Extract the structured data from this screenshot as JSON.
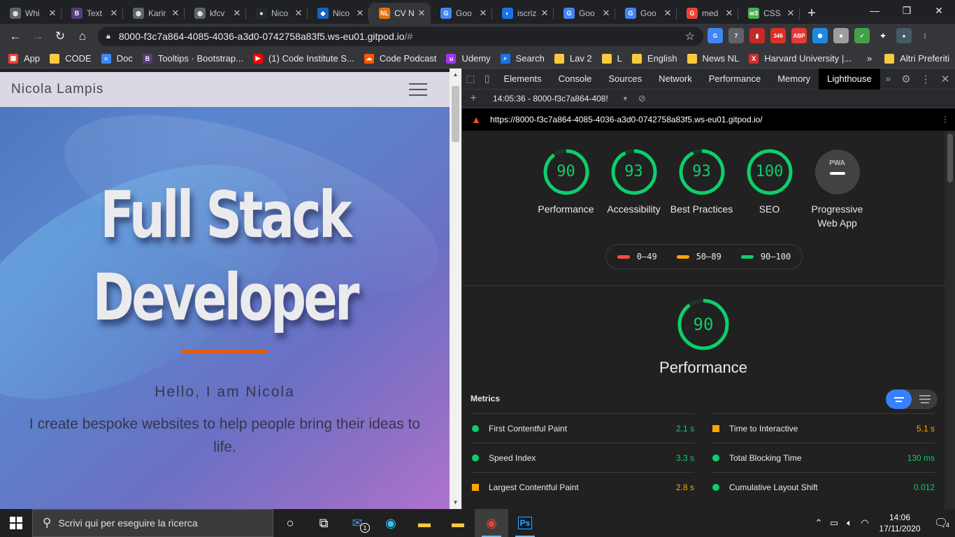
{
  "browser": {
    "tabs": [
      {
        "label": "Whi",
        "favicon": "globe-icon",
        "color": "#5f6368",
        "glyph": "◍"
      },
      {
        "label": "Text",
        "favicon": "bootstrap-icon",
        "color": "#563d7c",
        "glyph": "B"
      },
      {
        "label": "Karir",
        "favicon": "globe-icon",
        "color": "#5f6368",
        "glyph": "◍"
      },
      {
        "label": "kfcv",
        "favicon": "globe-icon",
        "color": "#5f6368",
        "glyph": "◍"
      },
      {
        "label": "Nico",
        "favicon": "github-icon",
        "color": "#24292e",
        "glyph": "●"
      },
      {
        "label": "Nico",
        "favicon": "cube-icon",
        "color": "#1565c0",
        "glyph": "◆"
      },
      {
        "label": "CV N",
        "favicon": "nl-icon",
        "color": "#e8710a",
        "glyph": "NL"
      },
      {
        "label": "Goo",
        "favicon": "google-translate-icon",
        "color": "#4285f4",
        "glyph": "G"
      },
      {
        "label": "iscriz",
        "favicon": "loop-icon",
        "color": "#1a73e8",
        "glyph": "◐"
      },
      {
        "label": "Goo",
        "favicon": "google-translate-icon",
        "color": "#4285f4",
        "glyph": "G"
      },
      {
        "label": "Goo",
        "favicon": "google-translate-icon",
        "color": "#4285f4",
        "glyph": "G"
      },
      {
        "label": "med",
        "favicon": "google-icon",
        "color": "#ea4335",
        "glyph": "G"
      },
      {
        "label": "CSS",
        "favicon": "w3-icon",
        "color": "#4caf50",
        "glyph": "w3"
      }
    ],
    "active_tab_index": 6,
    "new_tab": "+",
    "window_controls": {
      "minimize": "—",
      "maximize": "❐",
      "close": "✕"
    },
    "nav": {
      "back": "←",
      "forward": "→",
      "reload": "↻",
      "home": "⌂"
    },
    "url_host": "8000-f3c7a864-4085-4036-a3d0-0742758a83f5.ws-eu01.gitpod.io",
    "url_path": "/#",
    "star": "☆",
    "extensions": [
      {
        "name": "translate-ext-icon",
        "color": "#4285f4",
        "label": "G"
      },
      {
        "name": "tabs-ext-icon",
        "color": "#5f6368",
        "label": "7"
      },
      {
        "name": "book-ext-icon",
        "color": "#c62828",
        "label": "▮"
      },
      {
        "name": "mail-ext-icon",
        "color": "#d93025",
        "label": "346"
      },
      {
        "name": "abp-ext-icon",
        "color": "#e53935",
        "label": "ABP"
      },
      {
        "name": "hex-ext-icon",
        "color": "#1e88e5",
        "label": "⬢"
      },
      {
        "name": "box-ext-icon",
        "color": "#9e9e9e",
        "label": "■"
      },
      {
        "name": "check-ext-icon",
        "color": "#43a047",
        "label": "✓"
      },
      {
        "name": "puzzle-ext-icon",
        "color": "#35363a",
        "label": "✚"
      },
      {
        "name": "avatar-ext-icon",
        "color": "#455a64",
        "label": "●"
      },
      {
        "name": "menu-ext-icon",
        "color": "#35363a",
        "label": "⋮"
      }
    ]
  },
  "bookmarks": [
    {
      "label": "App",
      "icon": "apps-grid-icon",
      "color": "#ea4335",
      "glyph": "▦"
    },
    {
      "label": "CODE",
      "icon": "folder-icon",
      "color": "#f9c940",
      "glyph": ""
    },
    {
      "label": "Doc",
      "icon": "docs-icon",
      "color": "#4285f4",
      "glyph": "≡"
    },
    {
      "label": "Tooltips · Bootstrap...",
      "icon": "bootstrap-icon",
      "color": "#563d7c",
      "glyph": "B"
    },
    {
      "label": "(1) Code Institute S...",
      "icon": "youtube-icon",
      "color": "#ff0000",
      "glyph": "▶"
    },
    {
      "label": "Code Podcast",
      "icon": "soundcloud-icon",
      "color": "#ff5500",
      "glyph": "☁"
    },
    {
      "label": "Udemy",
      "icon": "udemy-icon",
      "color": "#a435f0",
      "glyph": "u"
    },
    {
      "label": "Search",
      "icon": "search-bm-icon",
      "color": "#1a73e8",
      "glyph": "⌕"
    },
    {
      "label": "Lav 2",
      "icon": "folder-icon",
      "color": "#f9c940",
      "glyph": ""
    },
    {
      "label": "L",
      "icon": "folder-icon",
      "color": "#f9c940",
      "glyph": ""
    },
    {
      "label": "English",
      "icon": "folder-icon",
      "color": "#f9c940",
      "glyph": ""
    },
    {
      "label": "News NL",
      "icon": "folder-icon",
      "color": "#f9c940",
      "glyph": ""
    },
    {
      "label": "Harvard University |...",
      "icon": "edx-icon",
      "color": "#d32f2f",
      "glyph": "X"
    }
  ],
  "bookmarks_more": "»",
  "bookmarks_other": "Altri Preferiti",
  "site": {
    "brand": "Nicola Lampis",
    "hero_title_line1": "Full Stack",
    "hero_title_line2": "Developer",
    "hello": "Hello, I am Nicola",
    "subtitle": "I create bespoke websites to help people bring their ideas to life.",
    "accent": "#e05d16"
  },
  "devtools": {
    "tabs": [
      "Elements",
      "Console",
      "Sources",
      "Network",
      "Performance",
      "Memory",
      "Lighthouse"
    ],
    "active_tab": "Lighthouse",
    "more": "»",
    "report_select": "14:05:36 - 8000-f3c7a864-408!",
    "report_url": "https://8000-f3c7a864-4085-4036-a3d0-0742758a83f5.ws-eu01.gitpod.io/"
  },
  "lighthouse": {
    "scores": [
      {
        "label": "Performance",
        "value": 90
      },
      {
        "label": "Accessibility",
        "value": 93
      },
      {
        "label": "Best Practices",
        "value": 93
      },
      {
        "label": "SEO",
        "value": 100
      }
    ],
    "pwa_label": "Progressive Web App",
    "pwa_badge": "PWA",
    "legend": [
      {
        "range": "0–49",
        "color": "#ff4e42"
      },
      {
        "range": "50–89",
        "color": "#ffa400"
      },
      {
        "range": "90–100",
        "color": "#0cce6b"
      }
    ],
    "section_title": "Performance",
    "section_score": 90,
    "metrics_heading": "Metrics",
    "metrics_left": [
      {
        "label": "First Contentful Paint",
        "value": "2.1 s",
        "status": "pass"
      },
      {
        "label": "Speed Index",
        "value": "3.3 s",
        "status": "pass"
      },
      {
        "label": "Largest Contentful Paint",
        "value": "2.8 s",
        "status": "avg"
      }
    ],
    "metrics_right": [
      {
        "label": "Time to Interactive",
        "value": "5.1 s",
        "status": "avg"
      },
      {
        "label": "Total Blocking Time",
        "value": "130 ms",
        "status": "pass"
      },
      {
        "label": "Cumulative Layout Shift",
        "value": "0.012",
        "status": "pass"
      }
    ],
    "colors": {
      "pass": "#0cce6b",
      "avg": "#ffa400",
      "fail": "#ff4e42"
    }
  },
  "taskbar": {
    "search_placeholder": "Scrivi qui per eseguire la ricerca",
    "mail_badge": "1",
    "time": "14:06",
    "date": "17/11/2020",
    "notifications": "4"
  }
}
